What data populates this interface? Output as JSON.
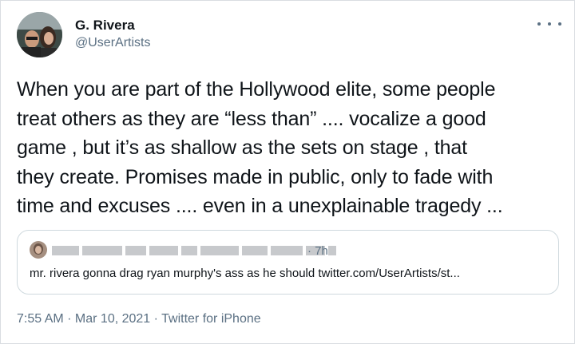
{
  "author": {
    "name": "G. Rivera",
    "handle": "@UserArtists"
  },
  "tweet": {
    "text": "When you are part of the Hollywood elite, some people\ntreat others as they are “less than” .... vocalize a good\ngame , but it’s as shallow as the sets on stage , that\nthey create. Promises made in public, only to fade with\ntime and excuses .... even in a unexplainable tragedy ..."
  },
  "quoted_tweet": {
    "time": "· 7h",
    "text": "mr. rivera gonna drag ryan murphy's ass as he should twitter.com/UserArtists/st..."
  },
  "meta": {
    "timestamp": "7:55 AM · Mar 10, 2021 · ",
    "source": "Twitter for iPhone"
  },
  "icons": {
    "more": "more-horizontal-icon"
  },
  "colors": {
    "text_primary": "#0f1419",
    "text_secondary": "#5b7083",
    "border": "#cfd9de"
  }
}
